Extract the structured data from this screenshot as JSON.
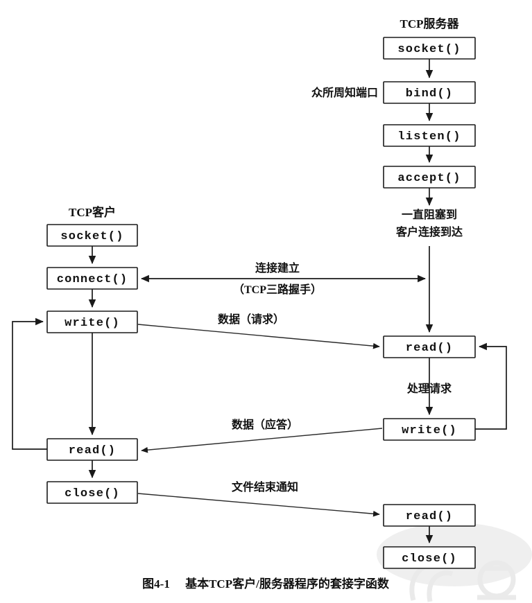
{
  "figure": {
    "caption_number": "图4-1",
    "caption_text": "基本TCP客户/服务器程序的套接字函数",
    "caption_full": "图4-1　基本TCP客户/服务器程序的套接字函数"
  },
  "columns": {
    "server": {
      "title": "TCP服务器",
      "steps": [
        {
          "id": "server-socket",
          "label": "socket()"
        },
        {
          "id": "server-bind",
          "label": "bind()"
        },
        {
          "id": "server-listen",
          "label": "listen()"
        },
        {
          "id": "server-accept",
          "label": "accept()"
        },
        {
          "id": "server-read-1",
          "label": "read()"
        },
        {
          "id": "server-write",
          "label": "write()"
        },
        {
          "id": "server-read-2",
          "label": "read()"
        },
        {
          "id": "server-close",
          "label": "close()"
        }
      ]
    },
    "client": {
      "title": "TCP客户",
      "steps": [
        {
          "id": "client-socket",
          "label": "socket()"
        },
        {
          "id": "client-connect",
          "label": "connect()"
        },
        {
          "id": "client-write",
          "label": "write()"
        },
        {
          "id": "client-read",
          "label": "read()"
        },
        {
          "id": "client-close",
          "label": "close()"
        }
      ]
    }
  },
  "annotations": {
    "well_known_port": "众所周知端口",
    "blocking_line1": "一直阻塞到",
    "blocking_line2": "客户连接到达",
    "connection_line1": "连接建立",
    "connection_line2": "（TCP三路握手）",
    "data_request": "数据（请求）",
    "data_reply": "数据（应答）",
    "process_request": "处理请求",
    "eof_notify": "文件结束通知"
  },
  "colors": {
    "background": "#ffffff",
    "line": "#1a1a1a",
    "text": "#111111",
    "box_fill": "#ffffff",
    "watermark": "#efefef"
  }
}
